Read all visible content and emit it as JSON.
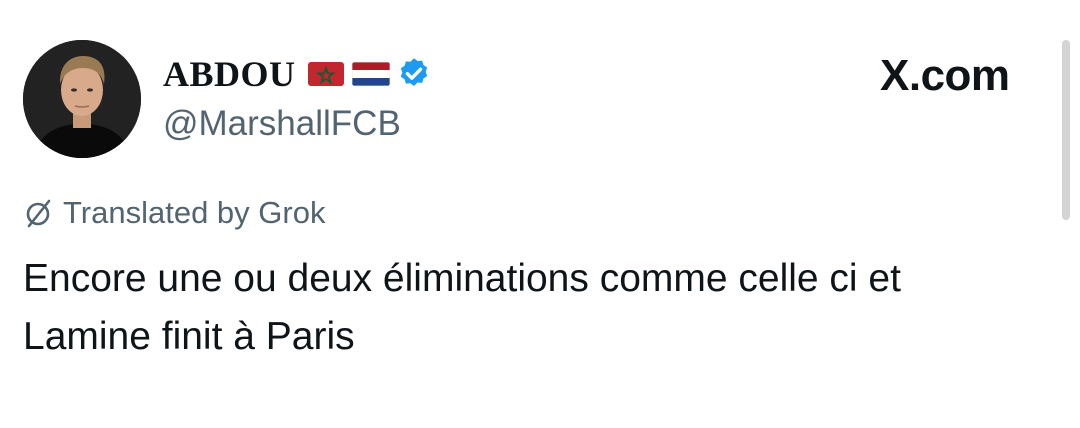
{
  "author": {
    "display_name": "ABDOU",
    "flags": [
      "morocco-flag",
      "netherlands-flag"
    ],
    "verified": true,
    "handle": "@MarshallFCB"
  },
  "brand": {
    "label": "X.com"
  },
  "translation": {
    "icon": "grok-icon",
    "label": "Translated by Grok"
  },
  "tweet": {
    "lines": [
      "Encore une ou deux éliminations comme celle ci et",
      "Lamine finit à Paris"
    ]
  },
  "colors": {
    "text": "#0f1419",
    "secondary": "#536471",
    "verified_blue": "#1d9bf0",
    "background": "#ffffff"
  }
}
